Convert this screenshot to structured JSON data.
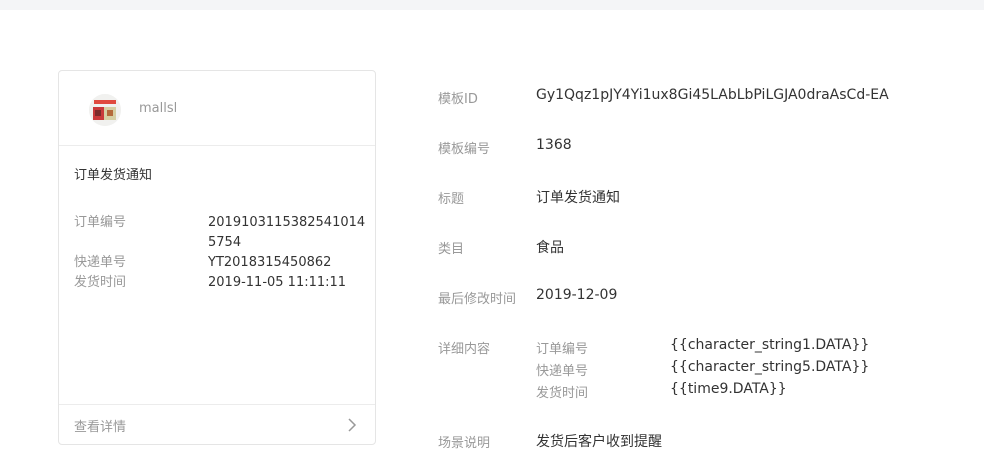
{
  "preview": {
    "shop_name": "mallsl",
    "title": "订单发货通知",
    "fields": [
      {
        "label": "订单编号",
        "value": "20191031153825410145754"
      },
      {
        "label": "快递单号",
        "value": "YT2018315450862"
      },
      {
        "label": "发货时间",
        "value": "2019-11-05 11:11:11"
      }
    ],
    "detail_link": "查看详情"
  },
  "info": {
    "template_id": {
      "label": "模板ID",
      "value": "Gy1Qqz1pJY4Yi1ux8Gi45LAbLbPiLGJA0draAsCd-EA"
    },
    "template_no": {
      "label": "模板编号",
      "value": "1368"
    },
    "title": {
      "label": "标题",
      "value": "订单发货通知"
    },
    "category": {
      "label": "类目",
      "value": "食品"
    },
    "modified": {
      "label": "最后修改时间",
      "value": "2019-12-09"
    },
    "details": {
      "label": "详细内容",
      "rows": [
        {
          "key": "订单编号",
          "value": "{{character_string1.DATA}}"
        },
        {
          "key": "快递单号",
          "value": "{{character_string5.DATA}}"
        },
        {
          "key": "发货时间",
          "value": "{{time9.DATA}}"
        }
      ]
    },
    "scenario": {
      "label": "场景说明",
      "value": "发货后客户收到提醒"
    }
  },
  "icons": {
    "avatar": "shop-avatar-image",
    "chevron": "chevron-right-icon"
  }
}
